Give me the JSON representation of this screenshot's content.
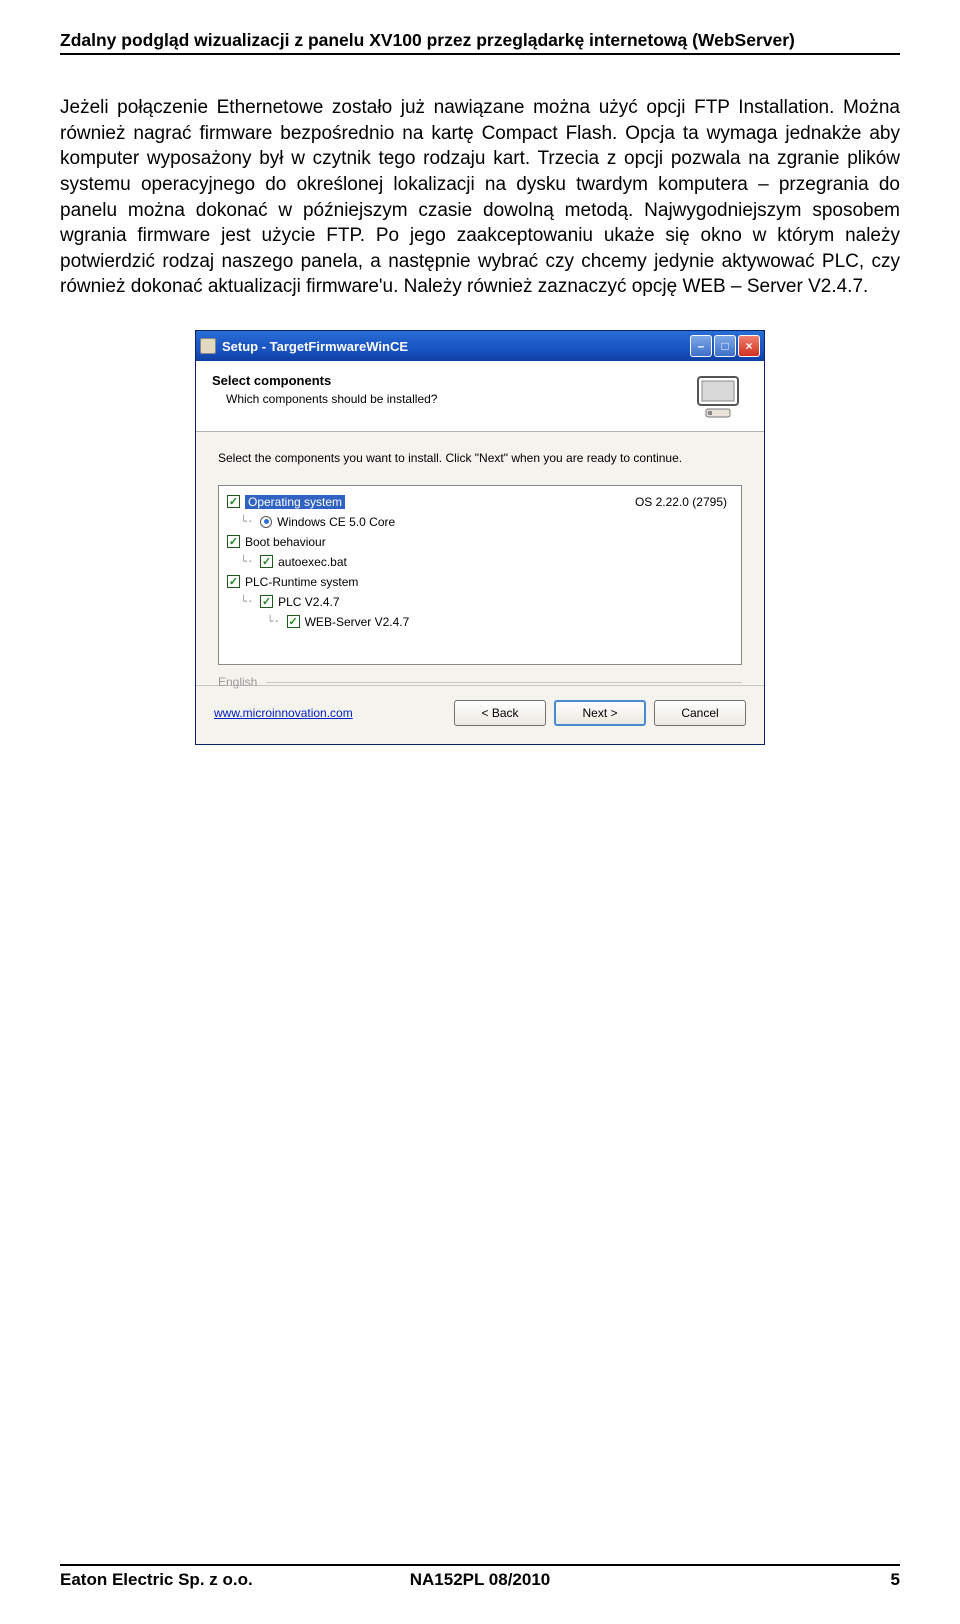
{
  "header": "Zdalny podgląd wizualizacji z panelu XV100 przez przeglądarkę internetową (WebServer)",
  "body_text": "Jeżeli połączenie Ethernetowe zostało już nawiązane można użyć opcji FTP Installation. Można również nagrać firmware bezpośrednio na kartę Compact Flash. Opcja ta wymaga jednakże aby komputer wyposażony był w czytnik tego rodzaju kart. Trzecia z opcji pozwala na zgranie plików systemu operacyjnego do określonej lokalizacji na dysku twardym komputera – przegrania do panelu można dokonać w późniejszym czasie dowolną metodą. Najwygodniejszym sposobem wgrania firmware jest użycie FTP. Po jego zaakceptowaniu ukaże się okno w którym należy potwierdzić rodzaj naszego panela, a następnie wybrać czy chcemy jedynie aktywować PLC, czy również dokonać aktualizacji firmware'u. Należy również zaznaczyć opcję WEB – Server V2.4.7.",
  "dialog": {
    "window_title": "Setup - TargetFirmwareWinCE",
    "title": "Select components",
    "subtitle": "Which components should be installed?",
    "instruction": "Select the components you want to install. Click \"Next\" when you are ready to continue.",
    "tree": {
      "os_label": "Operating system",
      "os_child": "Windows CE 5.0 Core",
      "os_version": "OS 2.22.0 (2795)",
      "boot_label": "Boot behaviour",
      "boot_child": "autoexec.bat",
      "plc_label": "PLC-Runtime system",
      "plc_child": "PLC V2.4.7",
      "web_child": "WEB-Server V2.4.7"
    },
    "language_label": "English",
    "link": "www.microinnovation.com",
    "btn_back": "< Back",
    "btn_next": "Next >",
    "btn_cancel": "Cancel"
  },
  "footer": {
    "left": "Eaton Electric Sp. z o.o.",
    "mid": "NA152PL 08/2010",
    "right": "5"
  }
}
